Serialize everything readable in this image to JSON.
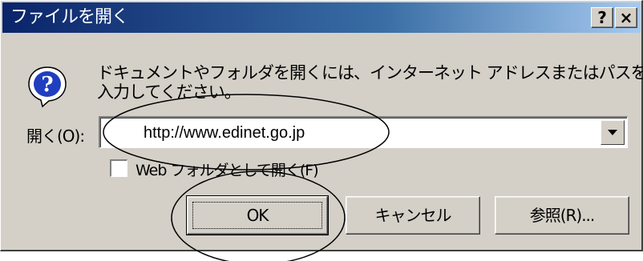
{
  "dialog": {
    "title": "ファイルを開く",
    "help_button": "?",
    "close_button": "×"
  },
  "message": {
    "line1": "ドキュメントやフォルダを開くには、インターネット アドレスまたはパスを",
    "line2": "入力してください。"
  },
  "open_field": {
    "label": "開く(O):",
    "value": "http://www.edinet.go.jp"
  },
  "web_folder_checkbox": {
    "label": "Web フォルダとして開く(F)",
    "checked": false
  },
  "buttons": {
    "ok": "OK",
    "cancel": "キャンセル",
    "browse": "参照(R)..."
  },
  "colors": {
    "titlebar_start": "#0a246a",
    "titlebar_end": "#a6caf0",
    "face": "#d4d0c8",
    "icon_blue": "#1f3fbf"
  },
  "icons": {
    "message": "question-icon",
    "dropdown": "chevron-down-icon"
  }
}
